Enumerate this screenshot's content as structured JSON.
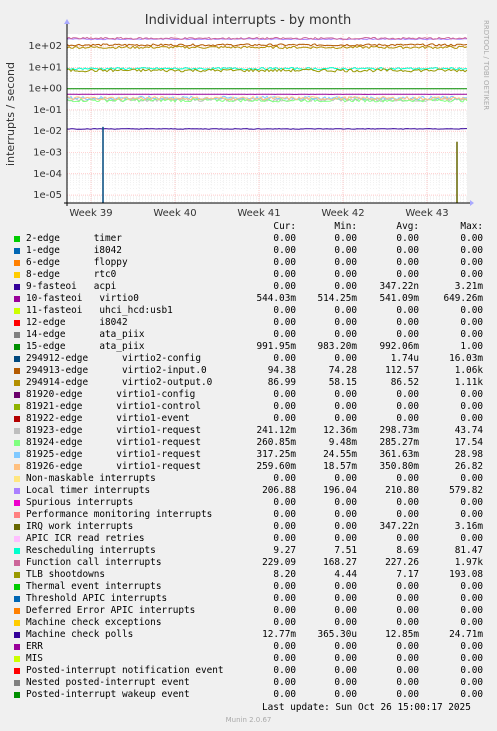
{
  "chart_data": {
    "type": "line",
    "title": "Individual interrupts - by month",
    "ylabel": "interrupts / second",
    "xlabel": "",
    "y_scale": "log",
    "ylim": [
      6e-06,
      300
    ],
    "y_ticks": [
      "1e+02",
      "1e+01",
      "1e+00",
      "1e-01",
      "1e-02",
      "1e-03",
      "1e-04",
      "1e-05"
    ],
    "x_ticks": [
      "Week 39",
      "Week 40",
      "Week 41",
      "Week 42",
      "Week 43"
    ],
    "side_label": "RRDTOOL / TOBI OETIKER",
    "columns": [
      "Cur:",
      "Min:",
      "Avg:",
      "Max:"
    ],
    "series": [
      {
        "name": "2-edge      timer",
        "color": "#00cc00",
        "cur": "0.00",
        "min": "0.00",
        "avg": "0.00",
        "max": "0.00"
      },
      {
        "name": "1-edge      i8042",
        "color": "#0066b3",
        "cur": "0.00",
        "min": "0.00",
        "avg": "0.00",
        "max": "0.00"
      },
      {
        "name": "6-edge      floppy",
        "color": "#ff8000",
        "cur": "0.00",
        "min": "0.00",
        "avg": "0.00",
        "max": "0.00"
      },
      {
        "name": "8-edge      rtc0",
        "color": "#ffcc00",
        "cur": "0.00",
        "min": "0.00",
        "avg": "0.00",
        "max": "0.00"
      },
      {
        "name": "9-fasteoi   acpi",
        "color": "#330099",
        "cur": "0.00",
        "min": "0.00",
        "avg": "347.22n",
        "max": "3.21m"
      },
      {
        "name": "10-fasteoi   virtio0",
        "color": "#990099",
        "cur": "544.03m",
        "min": "514.25m",
        "avg": "541.09m",
        "max": "649.26m"
      },
      {
        "name": "11-fasteoi   uhci_hcd:usb1",
        "color": "#ccff00",
        "cur": "0.00",
        "min": "0.00",
        "avg": "0.00",
        "max": "0.00"
      },
      {
        "name": "12-edge      i8042",
        "color": "#ff0000",
        "cur": "0.00",
        "min": "0.00",
        "avg": "0.00",
        "max": "0.00"
      },
      {
        "name": "14-edge      ata_piix",
        "color": "#808080",
        "cur": "0.00",
        "min": "0.00",
        "avg": "0.00",
        "max": "0.00"
      },
      {
        "name": "15-edge      ata_piix",
        "color": "#008f00",
        "cur": "991.95m",
        "min": "983.20m",
        "avg": "992.06m",
        "max": "1.00"
      },
      {
        "name": "294912-edge      virtio2-config",
        "color": "#00487d",
        "cur": "0.00",
        "min": "0.00",
        "avg": "1.74u",
        "max": "16.03m"
      },
      {
        "name": "294913-edge      virtio2-input.0",
        "color": "#b35a00",
        "cur": "94.38",
        "min": "74.28",
        "avg": "112.57",
        "max": "1.06k"
      },
      {
        "name": "294914-edge      virtio2-output.0",
        "color": "#b38f00",
        "cur": "86.99",
        "min": "58.15",
        "avg": "86.52",
        "max": "1.11k"
      },
      {
        "name": "81920-edge      virtio1-config",
        "color": "#6b006b",
        "cur": "0.00",
        "min": "0.00",
        "avg": "0.00",
        "max": "0.00"
      },
      {
        "name": "81921-edge      virtio1-control",
        "color": "#8fb300",
        "cur": "0.00",
        "min": "0.00",
        "avg": "0.00",
        "max": "0.00"
      },
      {
        "name": "81922-edge      virtio1-event",
        "color": "#b30000",
        "cur": "0.00",
        "min": "0.00",
        "avg": "0.00",
        "max": "0.00"
      },
      {
        "name": "81923-edge      virtio1-request",
        "color": "#bebebe",
        "cur": "241.12m",
        "min": "12.36m",
        "avg": "298.73m",
        "max": "43.74"
      },
      {
        "name": "81924-edge      virtio1-request",
        "color": "#80ff80",
        "cur": "260.85m",
        "min": "9.48m",
        "avg": "285.27m",
        "max": "17.54"
      },
      {
        "name": "81925-edge      virtio1-request",
        "color": "#80c9ff",
        "cur": "317.25m",
        "min": "24.55m",
        "avg": "361.63m",
        "max": "28.98"
      },
      {
        "name": "81926-edge      virtio1-request",
        "color": "#ffc080",
        "cur": "259.60m",
        "min": "18.57m",
        "avg": "350.80m",
        "max": "26.82"
      },
      {
        "name": "Non-maskable interrupts",
        "color": "#ffe680",
        "cur": "0.00",
        "min": "0.00",
        "avg": "0.00",
        "max": "0.00"
      },
      {
        "name": "Local timer interrupts",
        "color": "#aa80ff",
        "cur": "206.88",
        "min": "196.04",
        "avg": "210.80",
        "max": "579.82"
      },
      {
        "name": "Spurious interrupts",
        "color": "#ee00cc",
        "cur": "0.00",
        "min": "0.00",
        "avg": "0.00",
        "max": "0.00"
      },
      {
        "name": "Performance monitoring interrupts",
        "color": "#ff8080",
        "cur": "0.00",
        "min": "0.00",
        "avg": "0.00",
        "max": "0.00"
      },
      {
        "name": "IRQ work interrupts",
        "color": "#666600",
        "cur": "0.00",
        "min": "0.00",
        "avg": "347.22n",
        "max": "3.16m"
      },
      {
        "name": "APIC ICR read retries",
        "color": "#ffbfff",
        "cur": "0.00",
        "min": "0.00",
        "avg": "0.00",
        "max": "0.00"
      },
      {
        "name": "Rescheduling interrupts",
        "color": "#00ffcc",
        "cur": "9.27",
        "min": "7.51",
        "avg": "8.69",
        "max": "81.47"
      },
      {
        "name": "Function call interrupts",
        "color": "#cc6699",
        "cur": "229.09",
        "min": "168.27",
        "avg": "227.26",
        "max": "1.97k"
      },
      {
        "name": "TLB shootdowns",
        "color": "#999900",
        "cur": "8.20",
        "min": "4.44",
        "avg": "7.17",
        "max": "193.08"
      },
      {
        "name": "Thermal event interrupts",
        "color": "#00cc00",
        "cur": "0.00",
        "min": "0.00",
        "avg": "0.00",
        "max": "0.00"
      },
      {
        "name": "Threshold APIC interrupts",
        "color": "#0066b3",
        "cur": "0.00",
        "min": "0.00",
        "avg": "0.00",
        "max": "0.00"
      },
      {
        "name": "Deferred Error APIC interrupts",
        "color": "#ff8000",
        "cur": "0.00",
        "min": "0.00",
        "avg": "0.00",
        "max": "0.00"
      },
      {
        "name": "Machine check exceptions",
        "color": "#ffcc00",
        "cur": "0.00",
        "min": "0.00",
        "avg": "0.00",
        "max": "0.00"
      },
      {
        "name": "Machine check polls",
        "color": "#330099",
        "cur": "12.77m",
        "min": "365.30u",
        "avg": "12.85m",
        "max": "24.71m"
      },
      {
        "name": "ERR",
        "color": "#990099",
        "cur": "0.00",
        "min": "0.00",
        "avg": "0.00",
        "max": "0.00"
      },
      {
        "name": "MIS",
        "color": "#ccff00",
        "cur": "0.00",
        "min": "0.00",
        "avg": "0.00",
        "max": "0.00"
      },
      {
        "name": "Posted-interrupt notification event",
        "color": "#ff0000",
        "cur": "0.00",
        "min": "0.00",
        "avg": "0.00",
        "max": "0.00"
      },
      {
        "name": "Nested posted-interrupt event",
        "color": "#808080",
        "cur": "0.00",
        "min": "0.00",
        "avg": "0.00",
        "max": "0.00"
      },
      {
        "name": "Posted-interrupt wakeup event",
        "color": "#008f00",
        "cur": "0.00",
        "min": "0.00",
        "avg": "0.00",
        "max": "0.00"
      }
    ],
    "last_update": "Last update: Sun Oct 26 15:00:17 2025",
    "footer": "Munin 2.0.67"
  }
}
